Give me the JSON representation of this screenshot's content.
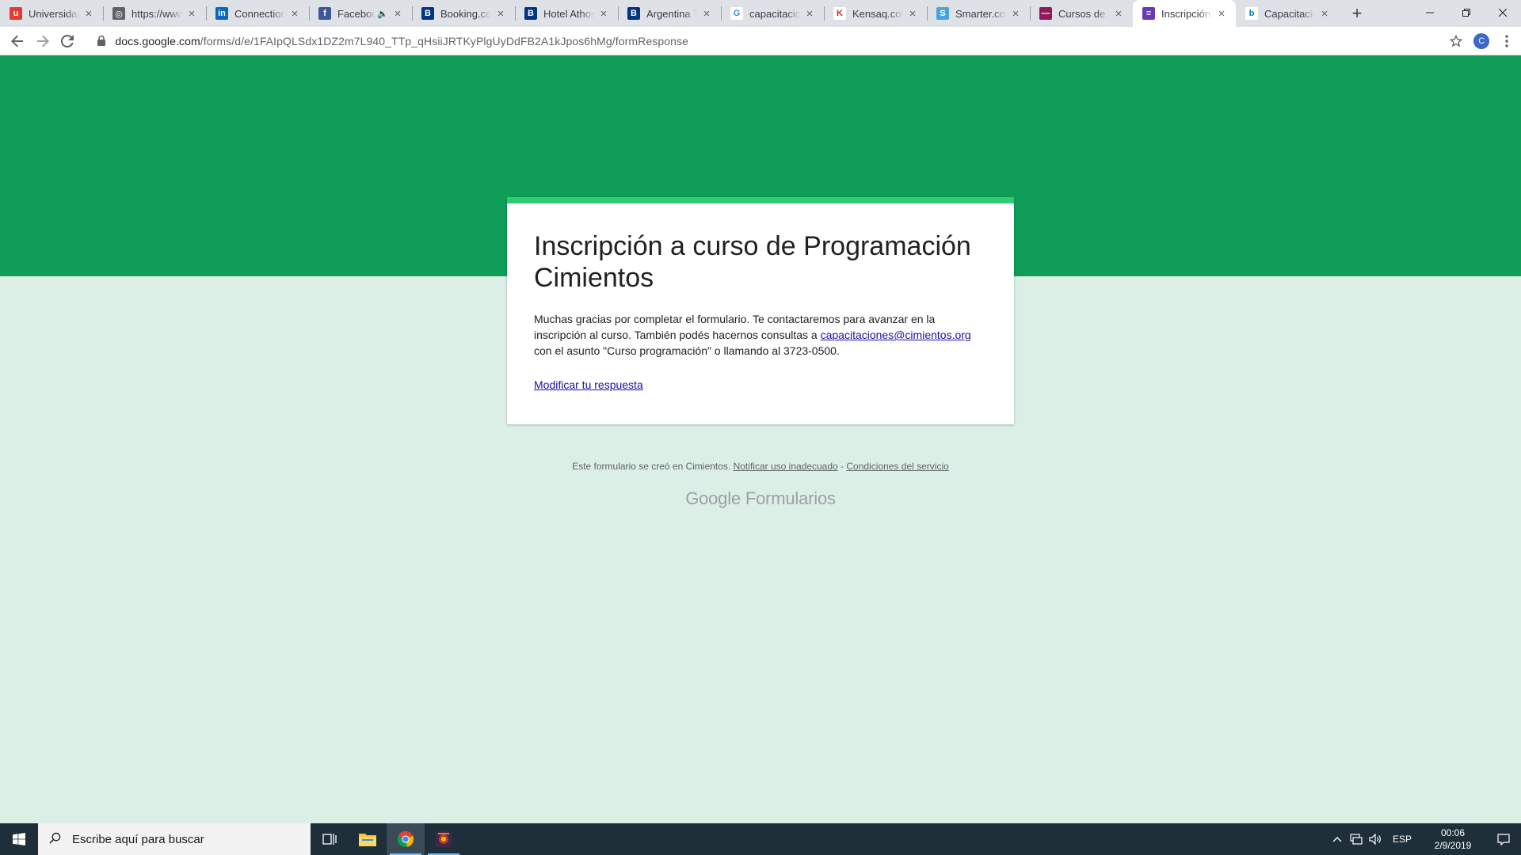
{
  "browser": {
    "tabs": [
      {
        "title": "Universidad",
        "icon": "universidad-favicon",
        "color": "#e53935",
        "glyph": "u",
        "active": false,
        "audio": false
      },
      {
        "title": "https://www",
        "icon": "globe-favicon",
        "color": "#5f6368",
        "glyph": "◎",
        "active": false,
        "audio": false
      },
      {
        "title": "Connection",
        "icon": "linkedin-favicon",
        "color": "#0a66c2",
        "glyph": "in",
        "active": false,
        "audio": false
      },
      {
        "title": "Faceboo",
        "icon": "facebook-favicon",
        "color": "#3b5998",
        "glyph": "f",
        "active": false,
        "audio": true
      },
      {
        "title": "Booking.com",
        "icon": "booking-favicon",
        "color": "#003580",
        "glyph": "B",
        "active": false,
        "audio": false
      },
      {
        "title": "Hotel Athos",
        "icon": "booking-favicon",
        "color": "#003580",
        "glyph": "B",
        "active": false,
        "audio": false
      },
      {
        "title": "Argentina Te",
        "icon": "booking-favicon",
        "color": "#003580",
        "glyph": "B",
        "active": false,
        "audio": false
      },
      {
        "title": "capacitacion",
        "icon": "google-favicon",
        "color": "#ffffff",
        "glyph": "G",
        "active": false,
        "audio": false
      },
      {
        "title": "Kensaq.com",
        "icon": "kensaq-favicon",
        "color": "#ffffff",
        "glyph": "K",
        "active": false,
        "audio": false
      },
      {
        "title": "Smarter.com",
        "icon": "smarter-favicon",
        "color": "#4aa3df",
        "glyph": "S",
        "active": false,
        "audio": false
      },
      {
        "title": "Cursos de p",
        "icon": "cursos-favicon",
        "color": "#8e1a5c",
        "glyph": "—",
        "active": false,
        "audio": false
      },
      {
        "title": "Inscripción a",
        "icon": "google-forms-favicon",
        "color": "#673ab7",
        "glyph": "≡",
        "active": true,
        "audio": false
      },
      {
        "title": "Capacitacio",
        "icon": "bing-favicon",
        "color": "#ffffff",
        "glyph": "b",
        "active": false,
        "audio": false
      }
    ],
    "new_tab_label": "+",
    "url_host": "docs.google.com",
    "url_path": "/forms/d/e/1FAIpQLSdx1DZ2m7L940_TTp_qHsiiJRTKyPlgUyDdFB2A1kJpos6hMg/formResponse",
    "profile_initial": "C"
  },
  "form": {
    "title": "Inscripción a curso de Programación Cimientos",
    "message_part1": "Muchas gracias por completar el formulario. Te contactaremos para avanzar en la inscripción al curso. También podés hacernos consultas a ",
    "email": "capacitaciones@cimientos.org",
    "message_part2": " con el asunto \"Curso programación\" o llamando al 3723-0500.",
    "edit_link": "Modificar tu respuesta",
    "accent_banner": "#0f9d58",
    "accent_card": "#2ecc71"
  },
  "footer": {
    "created_text": "Este formulario se creó en Cimientos.",
    "report_link": "Notificar uso inadecuado",
    "separator": " - ",
    "terms_link": "Condiciones del servicio",
    "brand_google": "Google",
    "brand_product": "Formularios"
  },
  "taskbar": {
    "search_placeholder": "Escribe aquí para buscar",
    "language": "ESP",
    "time": "00:06",
    "date": "2/9/2019"
  }
}
